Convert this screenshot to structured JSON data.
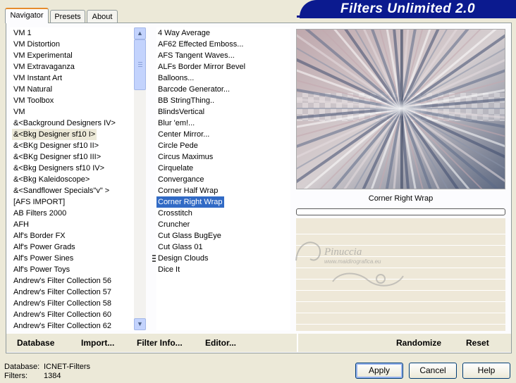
{
  "tabs": [
    "Navigator",
    "Presets",
    "About"
  ],
  "banner_title": "Filters Unlimited 2.0",
  "categories": [
    "VM 1",
    "VM Distortion",
    "VM Experimental",
    "VM Extravaganza",
    "VM Instant Art",
    "VM Natural",
    "VM Toolbox",
    "VM",
    "&<Background Designers IV>",
    "&<Bkg Designer sf10 I>",
    "&<BKg Designer sf10 II>",
    "&<BKg Designer sf10 III>",
    "&<Bkg Designers sf10 IV>",
    "&<Bkg Kaleidoscope>",
    "&<Sandflower Specials\"v\" >",
    "[AFS IMPORT]",
    "AB Filters 2000",
    "AFH",
    "Alf's Border FX",
    "Alf's Power Grads",
    "Alf's Power Sines",
    "Alf's Power Toys",
    "Andrew's Filter Collection 56",
    "Andrew's Filter Collection 57",
    "Andrew's Filter Collection 58",
    "Andrew's Filter Collection 60",
    "Andrew's Filter Collection 62"
  ],
  "filters": [
    "4 Way Average",
    "AF62 Effected Emboss...",
    "AFS Tangent Waves...",
    "ALFs Border Mirror Bevel",
    "Balloons...",
    "Barcode Generator...",
    "BB StringThing..",
    "BlindsVertical",
    "Blur 'em!...",
    "Center Mirror...",
    "Circle Pede",
    "Circus Maximus",
    "Cirquelate",
    "Convergance",
    "Corner Half Wrap",
    "Corner Right Wrap",
    "Crosstitch",
    "Cruncher",
    "Cut Glass  BugEye",
    "Cut Glass 01",
    "Design Clouds",
    "Dice It"
  ],
  "selected_filter_name": "Corner Right Wrap",
  "watermark": {
    "name": "Pinuccia",
    "url": "www.maidirografica.eu"
  },
  "toolbar": {
    "database": "Database",
    "import": "Import...",
    "filter_info": "Filter Info...",
    "editor": "Editor...",
    "randomize": "Randomize",
    "reset": "Reset"
  },
  "status": {
    "database_label": "Database:",
    "database_value": "ICNET-Filters",
    "filters_label": "Filters:",
    "filters_value": "1384"
  },
  "buttons": {
    "apply": "Apply",
    "cancel": "Cancel",
    "help": "Help"
  },
  "colors": {
    "banner": "#0b1a8f",
    "selection": "#316ac5",
    "accent_tab": "#e68b2c"
  }
}
